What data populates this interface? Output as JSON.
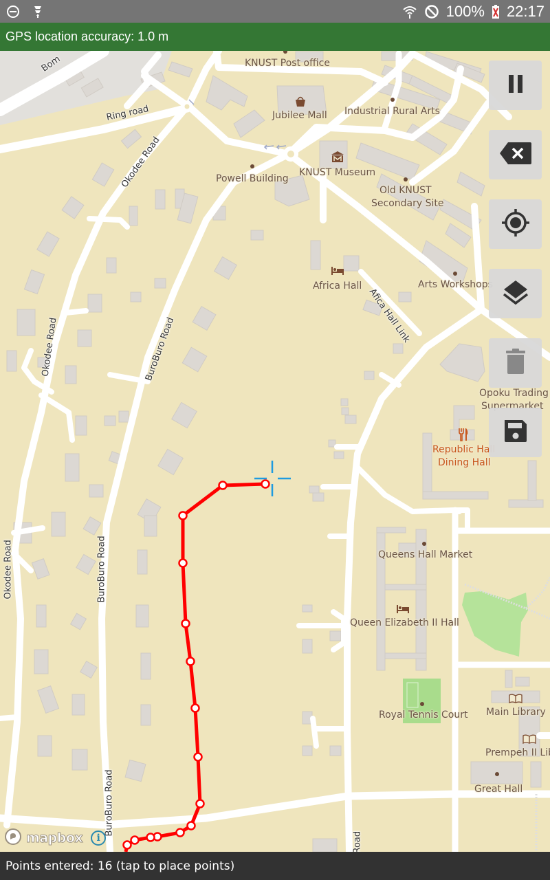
{
  "status_bar": {
    "left_icons": [
      "do-not-disturb-icon",
      "gps-satellite-icon"
    ],
    "right_icons": [
      "wifi-icon",
      "no-sim-icon",
      "battery-icon"
    ],
    "battery": "100%",
    "time": "22:17"
  },
  "gps_banner": {
    "text": "GPS location accuracy: 1.0 m",
    "color": "#347734"
  },
  "map": {
    "provider": "mapbox",
    "labels": {
      "post_office": "KNUST Post office",
      "jubilee_mall": "Jubilee Mall",
      "industrial_rural_arts": "Industrial Rural Arts",
      "knust_museum": "KNUST Museum",
      "powell_building": "Powell Building",
      "old_knust_1": "Old KNUST",
      "old_knust_2": "Secondary Site",
      "africa_hall": "Africa Hall",
      "arts_workshops": "Arts Workshops",
      "opoku_1": "Opoku Trading",
      "opoku_2": "Supermarket",
      "republic_hall_1": "Republic Hall",
      "republic_hall_2": "Dining Hall",
      "queens_hall_market": "Queens Hall Market",
      "queen_elizabeth": "Queen Elizabeth II Hall",
      "royal_tennis": "Royal Tennis Court",
      "main_library": "Main Library",
      "prempeh": "Prempeh II Library",
      "great_hall": "Great Hall"
    },
    "roads": {
      "bom": "Bom",
      "ring_road": "Ring road",
      "okodee_1": "Okodee Road",
      "okodee_2": "Okodee Road",
      "okodee_3": "Okodee Road",
      "buroburo_1": "BuroBuro Road",
      "buroburo_2": "BuroBuro Road",
      "buroburo_3": "BuroBuro Road",
      "africa_hall_link": "Afica Hall Link",
      "road_bottom": "Road"
    },
    "track": {
      "color": "#ff0000",
      "points_count": 16
    },
    "crosshair_color": "#1e9be0"
  },
  "controls": {
    "pause": "pause-icon",
    "backspace": "backspace-icon",
    "locate": "my-location-icon",
    "layers": "layers-icon",
    "delete": "trash-icon",
    "save": "save-icon"
  },
  "attribution": {
    "logo_text": "mapbox",
    "info": "i"
  },
  "bottom_bar": {
    "text": "Points entered: 16 (tap to place points)"
  }
}
